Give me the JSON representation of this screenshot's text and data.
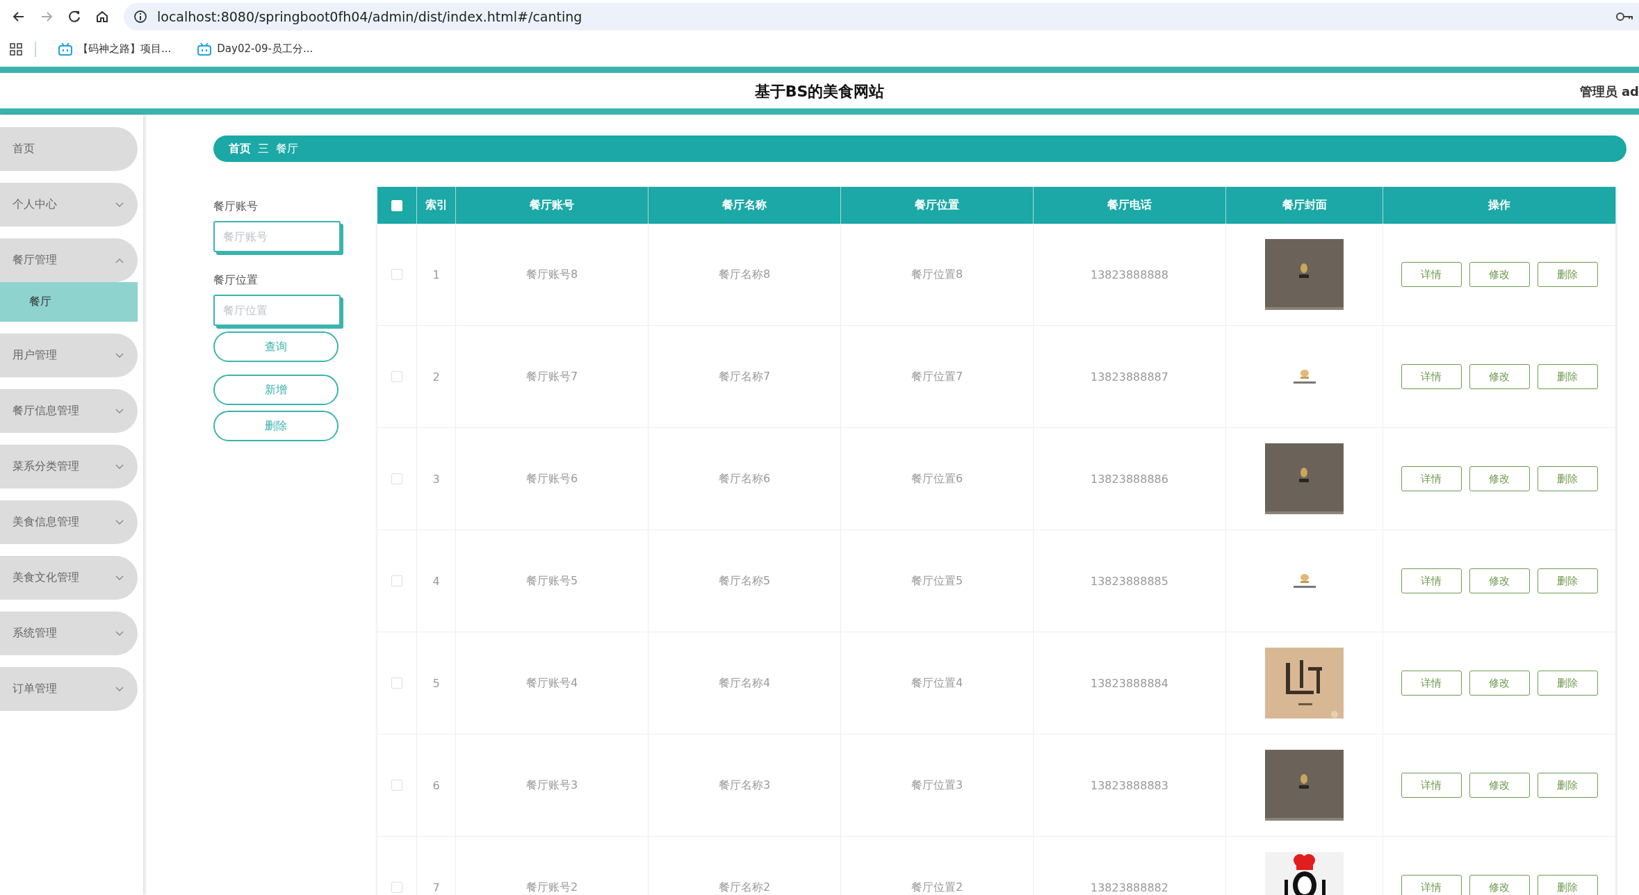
{
  "browser": {
    "url": "localhost:8080/springboot0fh04/admin/dist/index.html#/canting",
    "bookmarks": [
      "【码神之路】项目...",
      "Day02-09-员工分..."
    ]
  },
  "header": {
    "title": "基于BS的美食网站",
    "user": "管理员 ad"
  },
  "sidebar": {
    "items": [
      {
        "label": "首页",
        "kind": "link"
      },
      {
        "label": "个人中心",
        "kind": "menu",
        "expanded": false
      },
      {
        "label": "餐厅管理",
        "kind": "menu",
        "expanded": true,
        "children": [
          {
            "label": "餐厅",
            "selected": true
          }
        ]
      },
      {
        "label": "用户管理",
        "kind": "menu",
        "expanded": false
      },
      {
        "label": "餐厅信息管理",
        "kind": "menu",
        "expanded": false
      },
      {
        "label": "菜系分类管理",
        "kind": "menu",
        "expanded": false
      },
      {
        "label": "美食信息管理",
        "kind": "menu",
        "expanded": false
      },
      {
        "label": "美食文化管理",
        "kind": "menu",
        "expanded": false
      },
      {
        "label": "系统管理",
        "kind": "menu",
        "expanded": false
      },
      {
        "label": "订单管理",
        "kind": "menu",
        "expanded": false
      }
    ]
  },
  "breadcrumb": {
    "items": [
      "首页",
      "餐厅"
    ],
    "separator": "三"
  },
  "search": {
    "fields": [
      {
        "label": "餐厅账号",
        "placeholder": "餐厅账号"
      },
      {
        "label": "餐厅位置",
        "placeholder": "餐厅位置"
      }
    ],
    "buttons": [
      "查询",
      "新增",
      "删除"
    ]
  },
  "table": {
    "header_checked": false,
    "columns": [
      "索引",
      "餐厅账号",
      "餐厅名称",
      "餐厅位置",
      "餐厅电话",
      "餐厅封面",
      "操作"
    ],
    "rows": [
      {
        "checked": false,
        "index": "1",
        "account": "餐厅账号8",
        "name": "餐厅名称8",
        "location": "餐厅位置8",
        "phone": "13823888888",
        "actions": [
          "详情",
          "修改",
          "删除"
        ]
      },
      {
        "checked": false,
        "index": "2",
        "account": "餐厅账号7",
        "name": "餐厅名称7",
        "location": "餐厅位置7",
        "phone": "13823888887",
        "actions": [
          "详情",
          "修改",
          "删除"
        ]
      },
      {
        "checked": false,
        "index": "3",
        "account": "餐厅账号6",
        "name": "餐厅名称6",
        "location": "餐厅位置6",
        "phone": "13823888886",
        "actions": [
          "详情",
          "修改",
          "删除"
        ]
      },
      {
        "checked": false,
        "index": "4",
        "account": "餐厅账号5",
        "name": "餐厅名称5",
        "location": "餐厅位置5",
        "phone": "13823888885",
        "actions": [
          "详情",
          "修改",
          "删除"
        ]
      },
      {
        "checked": false,
        "index": "5",
        "account": "餐厅账号4",
        "name": "餐厅名称4",
        "location": "餐厅位置4",
        "phone": "13823888884",
        "actions": [
          "详情",
          "修改",
          "删除"
        ]
      },
      {
        "checked": false,
        "index": "6",
        "account": "餐厅账号3",
        "name": "餐厅名称3",
        "location": "餐厅位置3",
        "phone": "13823888883",
        "actions": [
          "详情",
          "修改",
          "删除"
        ]
      },
      {
        "checked": false,
        "index": "7",
        "account": "餐厅账号2",
        "name": "餐厅名称2",
        "location": "餐厅位置2",
        "phone": "13823888882",
        "actions": [
          "详情",
          "修改",
          "删除"
        ]
      }
    ]
  }
}
